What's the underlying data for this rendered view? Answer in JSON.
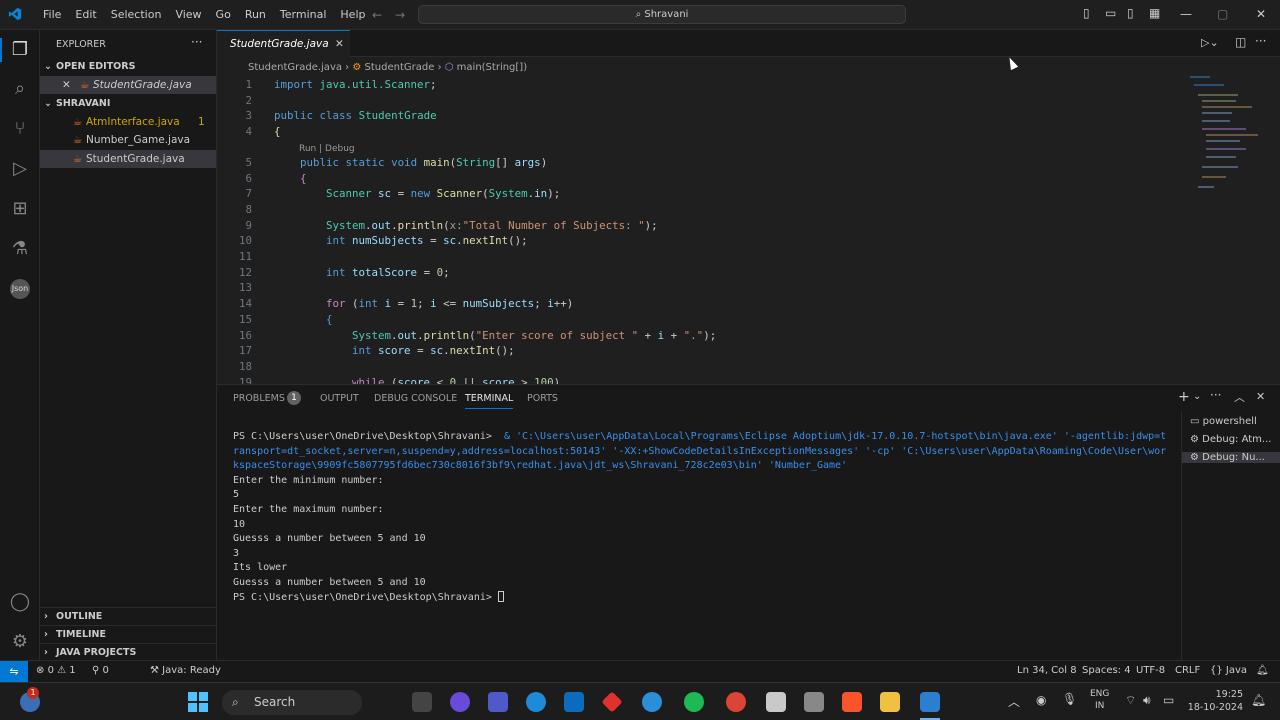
{
  "menu": [
    "File",
    "Edit",
    "Selection",
    "View",
    "Go",
    "Run",
    "Terminal",
    "Help"
  ],
  "command_center": "Shravani",
  "sidebar": {
    "title": "EXPLORER",
    "open_editors": {
      "label": "OPEN EDITORS",
      "file": "StudentGrade.java"
    },
    "folder": {
      "label": "SHRAVANI",
      "files": [
        {
          "name": "AtmInterface.java",
          "badge": "1",
          "color": "#cca700"
        },
        {
          "name": "Number_Game.java",
          "badge": "",
          "color": "#cccccc"
        },
        {
          "name": "StudentGrade.java",
          "badge": "",
          "color": "#cccccc"
        }
      ]
    },
    "outline": "OUTLINE",
    "timeline": "TIMELINE",
    "java_projects": "JAVA PROJECTS"
  },
  "editor": {
    "tab": "StudentGrade.java",
    "breadcrumbs": [
      "StudentGrade.java",
      "StudentGrade",
      "main(String[])"
    ],
    "codelens": "Run | Debug",
    "lines": [
      {
        "n": "1",
        "html": "<span class='kw'>import</span> <span class='ty'>java.util.Scanner</span>;"
      },
      {
        "n": "2",
        "html": ""
      },
      {
        "n": "3",
        "html": "<span class='kw'>public</span> <span class='kw'>class</span> <span class='ty'>StudentGrade</span>"
      },
      {
        "n": "4",
        "html": "<span class='fn'>{</span>"
      },
      {
        "n": "5",
        "html": "    <span class='kw'>public</span> <span class='kw'>static</span> <span class='kw'>void</span> <span class='fn'>main</span>(<span class='ty'>String</span>[] <span class='vr'>args</span>)"
      },
      {
        "n": "6",
        "html": "    <span class='ct'>{</span>"
      },
      {
        "n": "7",
        "html": "        <span class='ty'>Scanner</span> <span class='vr'>sc</span> = <span class='kw'>new</span> <span class='fn'>Scanner</span>(<span class='ty'>System</span>.<span class='vr'>in</span>);"
      },
      {
        "n": "8",
        "html": ""
      },
      {
        "n": "9",
        "html": "        <span class='ty'>System</span>.<span class='vr'>out</span>.<span class='fn'>println</span>(<span class='pm'>x:</span><span class='st'>\"Total Number of Subjects: \"</span>);"
      },
      {
        "n": "10",
        "html": "        <span class='kw'>int</span> <span class='vr'>numSubjects</span> = <span class='vr'>sc</span>.<span class='fn'>nextInt</span>();"
      },
      {
        "n": "11",
        "html": ""
      },
      {
        "n": "12",
        "html": "        <span class='kw'>int</span> <span class='vr'>totalScore</span> = <span class='nu'>0</span>;"
      },
      {
        "n": "13",
        "html": ""
      },
      {
        "n": "14",
        "html": "        <span class='ct'>for</span> (<span class='kw'>int</span> <span class='vr'>i</span> = <span class='nu'>1</span>; <span class='vr'>i</span> &lt;= <span class='vr'>numSubjects</span>; <span class='vr'>i</span>++)"
      },
      {
        "n": "15",
        "html": "        <span class='kw'>{</span>"
      },
      {
        "n": "16",
        "html": "            <span class='ty'>System</span>.<span class='vr'>out</span>.<span class='fn'>println</span>(<span class='st'>\"Enter score of subject \"</span> + <span class='vr'>i</span> + <span class='st'>\".\"</span>);"
      },
      {
        "n": "17",
        "html": "            <span class='kw'>int</span> <span class='vr'>score</span> = <span class='vr'>sc</span>.<span class='fn'>nextInt</span>();"
      },
      {
        "n": "18",
        "html": ""
      },
      {
        "n": "19",
        "html": "            <span class='ct'>while</span> (<span class='vr'>score</span> &lt; <span class='nu'>0</span> || <span class='vr'>score</span> &gt; <span class='nu'>100</span>)"
      }
    ]
  },
  "panel": {
    "tabs": [
      "PROBLEMS",
      "OUTPUT",
      "DEBUG CONSOLE",
      "TERMINAL",
      "PORTS"
    ],
    "problems_count": "1",
    "terminal_lines": [
      "PS C:\\Users\\user\\OneDrive\\Desktop\\Shravani>  & 'C:\\Users\\user\\AppData\\Local\\Programs\\Eclipse Adoptium\\jdk-17.0.10.7-hotspot\\bin\\java.exe' '-agentlib:jdwp=transport=dt_socket,server=n,suspend=y,address=localhost:50143' '-XX:+ShowCodeDetailsInExceptionMessages' '-cp' 'C:\\Users\\user\\AppData\\Roaming\\Code\\User\\workspaceStorage\\9909fc5807795fd6bec730c8016f3bf9\\redhat.java\\jdt_ws\\Shravani_728c2e03\\bin' 'Number_Game'",
      "Enter the minimum number:",
      "5",
      "Enter the maximum number:",
      "10",
      "Guesss a number between 5 and 10",
      "3",
      "Its lower",
      "Guesss a number between 5 and 10",
      "PS C:\\Users\\user\\OneDrive\\Desktop\\Shravani> "
    ],
    "terminal_list": [
      "powershell",
      "Debug: Atm...",
      "Debug: Nu..."
    ]
  },
  "status": {
    "errors": "0",
    "warnings": "1",
    "ports": "0",
    "java": "Java: Ready",
    "position": "Ln 34, Col 8",
    "spaces": "Spaces: 4",
    "encoding": "UTF-8",
    "eol": "CRLF",
    "language": "Java"
  },
  "taskbar": {
    "search": "Search",
    "lang": "ENG",
    "region": "IN",
    "time": "19:25",
    "date": "18-10-2024",
    "notification_badge": "1"
  }
}
